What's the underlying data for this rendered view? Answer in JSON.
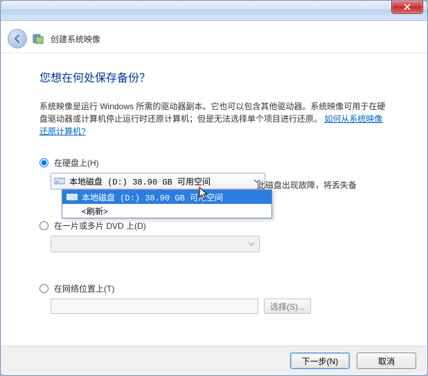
{
  "window": {
    "title": "创建系统映像"
  },
  "page": {
    "heading": "您想在何处保存备份？",
    "description_1": "系统映像是运行 Windows 所需的驱动器副本。它也可以包含其他驱动器。系统映像可用于在硬盘驱动器或计算机停止运行时还原计算机；但是无法选择单个项目进行还原。",
    "help_link": "如何从系统映像还原计算机?"
  },
  "options": {
    "hard_disk": {
      "label": "在硬盘上(H)",
      "selected_value": "本地磁盘 (D:) 38.90 GB 可用空间",
      "dropdown": [
        "本地磁盘 (D:) 38.90 GB 可用空间",
        "<刷新>"
      ],
      "warning": "此磁盘出现故障，将丢失备"
    },
    "dvd": {
      "label": "在一片或多片 DVD 上(D)"
    },
    "network": {
      "label": "在网络位置上(T)",
      "browse_label": "选择(S)..."
    }
  },
  "footer": {
    "next": "下一步(N)",
    "cancel": "取消"
  }
}
